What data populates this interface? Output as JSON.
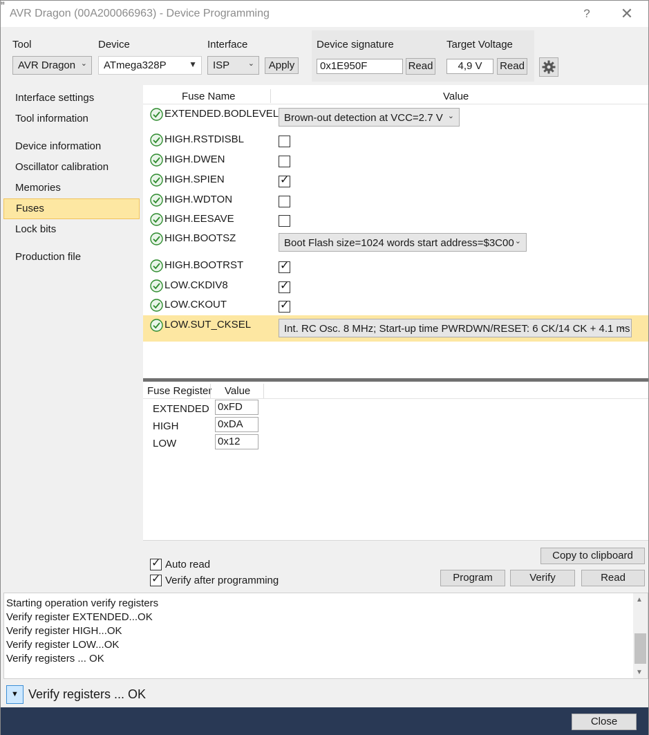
{
  "window": {
    "title": "AVR Dragon (00A200066963) - Device Programming",
    "help_label": "?",
    "close_glyph": "✕"
  },
  "toolbar": {
    "tool_label": "Tool",
    "tool_value": "AVR Dragon",
    "device_label": "Device",
    "device_value": "ATmega328P",
    "interface_label": "Interface",
    "interface_value": "ISP",
    "apply_label": "Apply",
    "signature_label": "Device signature",
    "signature_value": "0x1E950F",
    "signature_read_label": "Read",
    "voltage_label": "Target Voltage",
    "voltage_value": "4,9 V",
    "voltage_read_label": "Read"
  },
  "sidebar": {
    "items": [
      {
        "label": "Interface settings",
        "selected": false
      },
      {
        "label": "Tool information",
        "selected": false
      },
      {
        "label": "Device information",
        "selected": false
      },
      {
        "label": "Oscillator calibration",
        "selected": false
      },
      {
        "label": "Memories",
        "selected": false
      },
      {
        "label": "Fuses",
        "selected": true
      },
      {
        "label": "Lock bits",
        "selected": false
      },
      {
        "label": "Production file",
        "selected": false
      }
    ]
  },
  "fuses": {
    "col_name": "Fuse Name",
    "col_value": "Value",
    "rows": [
      {
        "name": "EXTENDED.BODLEVEL",
        "type": "select",
        "value": "Brown-out detection at VCC=2.7 V"
      },
      {
        "name": "HIGH.RSTDISBL",
        "type": "check",
        "checked": false
      },
      {
        "name": "HIGH.DWEN",
        "type": "check",
        "checked": false
      },
      {
        "name": "HIGH.SPIEN",
        "type": "check",
        "checked": true
      },
      {
        "name": "HIGH.WDTON",
        "type": "check",
        "checked": false
      },
      {
        "name": "HIGH.EESAVE",
        "type": "check",
        "checked": false
      },
      {
        "name": "HIGH.BOOTSZ",
        "type": "select",
        "value": "Boot Flash size=1024 words start address=$3C00"
      },
      {
        "name": "HIGH.BOOTRST",
        "type": "check",
        "checked": true
      },
      {
        "name": "LOW.CKDIV8",
        "type": "check",
        "checked": true
      },
      {
        "name": "LOW.CKOUT",
        "type": "check",
        "checked": true
      },
      {
        "name": "LOW.SUT_CKSEL",
        "type": "select",
        "value": "Int. RC Osc. 8 MHz; Start-up time PWRDWN/RESET: 6 CK/14 CK + 4.1 ms",
        "selected": true
      }
    ]
  },
  "registers": {
    "col_register": "Fuse Register",
    "col_value": "Value",
    "rows": [
      {
        "name": "EXTENDED",
        "value": "0xFD"
      },
      {
        "name": "HIGH",
        "value": "0xDA"
      },
      {
        "name": "LOW",
        "value": "0x12"
      }
    ]
  },
  "options": {
    "auto_read_label": "Auto read",
    "auto_read_checked": true,
    "verify_label": "Verify after programming",
    "verify_checked": true
  },
  "actions": {
    "copy_label": "Copy to clipboard",
    "program_label": "Program",
    "verify_label": "Verify",
    "read_label": "Read"
  },
  "log": {
    "lines": [
      "Starting operation verify registers",
      "Verify register EXTENDED...OK",
      "Verify register HIGH...OK",
      "Verify register LOW...OK",
      "Verify registers ... OK"
    ]
  },
  "status": {
    "text": "Verify registers ... OK"
  },
  "footer": {
    "close_label": "Close"
  },
  "colors": {
    "selection_bg": "#fde7a2",
    "ok_green": "#2e8b2e",
    "footer_bg": "#293955"
  }
}
